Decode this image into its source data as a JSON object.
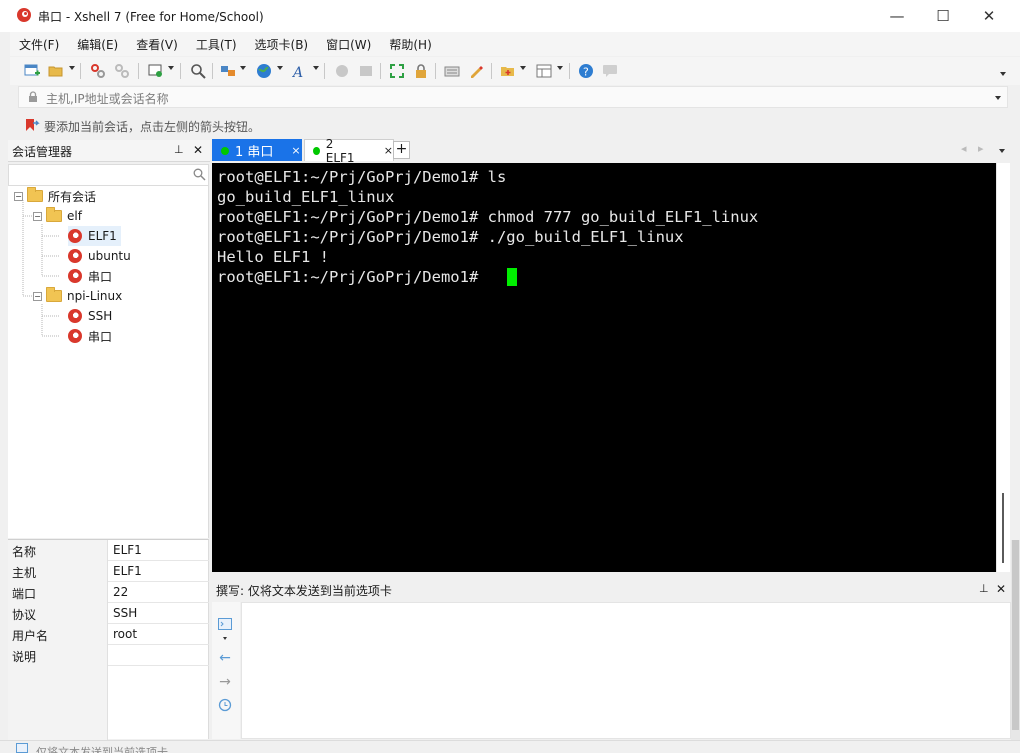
{
  "window": {
    "title": "串口 - Xshell 7 (Free for Home/School)",
    "buttons": {
      "minimize": "—",
      "maximize": "☐",
      "close": "✕"
    }
  },
  "menu": [
    "文件(F)",
    "编辑(E)",
    "查看(V)",
    "工具(T)",
    "选项卡(B)",
    "窗口(W)",
    "帮助(H)"
  ],
  "address": {
    "placeholder": "主机,IP地址或会话名称"
  },
  "hint": "要添加当前会话，点击左侧的箭头按钮。",
  "session_manager": {
    "title": "会话管理器",
    "pin": "⊥",
    "close": "✕",
    "tree": {
      "root": "所有会话",
      "folders": [
        {
          "label": "elf",
          "items": [
            "ELF1",
            "ubuntu",
            "串口"
          ]
        },
        {
          "label": "npi-Linux",
          "items": [
            "SSH",
            "串口"
          ]
        }
      ]
    }
  },
  "properties": [
    {
      "key": "名称",
      "value": "ELF1"
    },
    {
      "key": "主机",
      "value": "ELF1"
    },
    {
      "key": "端口",
      "value": "22"
    },
    {
      "key": "协议",
      "value": "SSH"
    },
    {
      "key": "用户名",
      "value": "root"
    },
    {
      "key": "说明",
      "value": ""
    }
  ],
  "tabs": [
    {
      "label": "1 串口",
      "active": true,
      "close": "×"
    },
    {
      "label": "2 ELF1",
      "active": false,
      "close": "×"
    }
  ],
  "new_tab": "+",
  "terminal": {
    "lines": [
      "root@ELF1:~/Prj/GoPrj/Demo1# ls",
      "go_build_ELF1_linux",
      "root@ELF1:~/Prj/GoPrj/Demo1# chmod 777 go_build_ELF1_linux",
      "root@ELF1:~/Prj/GoPrj/Demo1# ./go_build_ELF1_linux",
      "Hello ELF1 !",
      "root@ELF1:~/Prj/GoPrj/Demo1# "
    ]
  },
  "compose": {
    "label": "撰写: 仅将文本发送到当前选项卡",
    "pin": "⊥",
    "close": "✕"
  },
  "status_text": "仅将文本发送到当前选项卡",
  "colors": {
    "terminal_bg": "#000000",
    "terminal_fg": "#e8e8e8",
    "cursor": "#00ee00",
    "active_tab_bg": "#1a73e8",
    "tab_dot": "#00c800"
  },
  "icons": [
    "new-session-icon",
    "open-folder-icon",
    "connect-icon",
    "disconnect-icon",
    "properties-icon",
    "find-icon",
    "transfer-icon",
    "globe-icon",
    "font-icon",
    "script-icon",
    "fullscreen-icon",
    "lock-icon",
    "keyboard-icon",
    "highlight-icon",
    "new-tab-icon",
    "layout-icon",
    "help-icon",
    "chat-icon"
  ]
}
